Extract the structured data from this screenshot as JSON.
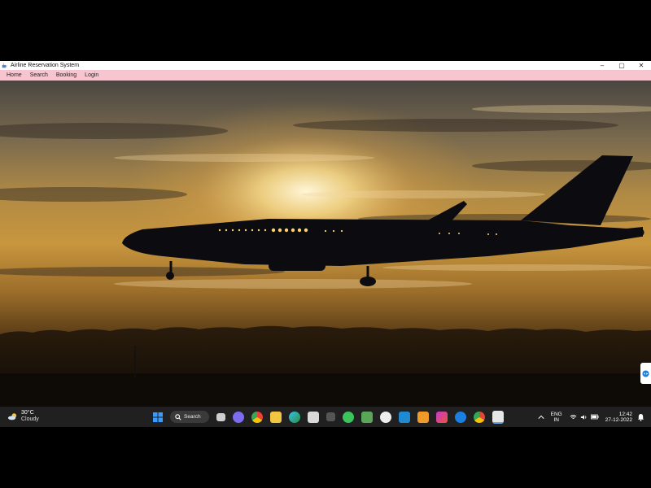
{
  "window": {
    "title": "Airline Reservation System",
    "controls": {
      "minimize": "–",
      "maximize": "▢",
      "close": "✕"
    }
  },
  "menu": {
    "items": [
      {
        "label": "Home"
      },
      {
        "label": "Search"
      },
      {
        "label": "Booking"
      },
      {
        "label": "Login"
      }
    ]
  },
  "content": {
    "image_description_icon": "airplane-sunset-photo"
  },
  "taskbar": {
    "weather": {
      "temp": "30°C",
      "condition": "Cloudy",
      "icon": "cloud-sun-icon"
    },
    "search_label": "Search",
    "apps": [
      {
        "name": "start-button",
        "color": "#3a9bff"
      },
      {
        "name": "task-view-icon",
        "color": "#cfcfcf"
      },
      {
        "name": "chat-icon",
        "color": "#7b6cf0"
      },
      {
        "name": "chrome-icon",
        "color": "#e8b32a"
      },
      {
        "name": "file-explorer-icon",
        "color": "#f3c642"
      },
      {
        "name": "edge-icon",
        "color": "#27a3d8"
      },
      {
        "name": "store-icon",
        "color": "#d9d9d9"
      },
      {
        "name": "app-icon-g",
        "color": "#555555"
      },
      {
        "name": "whatsapp-icon",
        "color": "#3bc45b"
      },
      {
        "name": "notepad-icon",
        "color": "#5aa75a"
      },
      {
        "name": "media-icon",
        "color": "#eeeeee"
      },
      {
        "name": "vscode-icon",
        "color": "#1f8ad2"
      },
      {
        "name": "sublime-icon",
        "color": "#f09a2a"
      },
      {
        "name": "intellij-icon",
        "color": "#c23ad2"
      },
      {
        "name": "teamviewer-icon",
        "color": "#1a7fe0"
      },
      {
        "name": "chrome-icon-2",
        "color": "#e8b32a"
      },
      {
        "name": "java-app-icon",
        "color": "#e66b5c"
      }
    ],
    "language": {
      "line1": "ENG",
      "line2": "IN"
    },
    "time": "12:42",
    "date": "27-12-2022"
  }
}
